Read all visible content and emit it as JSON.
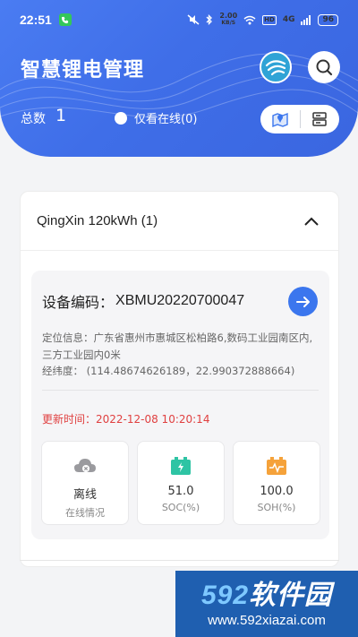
{
  "status_bar": {
    "time": "22:51",
    "speed_value": "2.00",
    "speed_unit": "KB/S",
    "hd": "HD",
    "network": "4G",
    "battery": "96"
  },
  "header": {
    "title": "智慧锂电管理",
    "total_label": "总数",
    "total_value": "1",
    "online_filter_label": "仅看在线(0)"
  },
  "group": {
    "title": "QingXin 120kWh (1)"
  },
  "device": {
    "code_label": "设备编码：",
    "code_value": "XBMU20220700047",
    "location_text": "定位信息：广东省惠州市惠城区松柏路6,数码工业园南区内,三方工业园内0米",
    "coords_text": "经纬度：  (114.48674626189，22.990372888664)",
    "update_text": "更新时间：2022-12-08 10:20:14"
  },
  "stats": [
    {
      "value": "离线",
      "label": "在线情况",
      "icon": "cloud-offline-icon"
    },
    {
      "value": "51.0",
      "label": "SOC(%)",
      "icon": "battery-charge-icon"
    },
    {
      "value": "100.0",
      "label": "SOH(%)",
      "icon": "battery-health-icon"
    }
  ],
  "watermark": {
    "big_num": "592",
    "big_text": "软件园",
    "url": "www.592xiazai.com"
  },
  "colors": {
    "primary": "#3b76ee",
    "alert": "#e04040",
    "soc_icon": "#2ec4a4",
    "soh_icon": "#f5a23a"
  }
}
